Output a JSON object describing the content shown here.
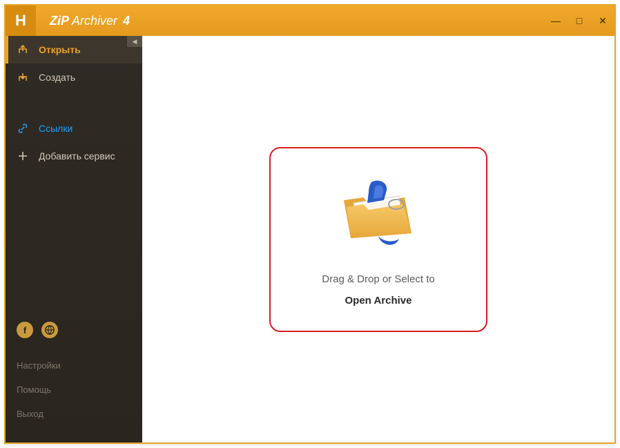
{
  "titlebar": {
    "logo_letter": "H",
    "zip": "ZiP",
    "archiver": "Archiver",
    "version": "4"
  },
  "window_controls": {
    "minimize": "—",
    "maximize": "□",
    "close": "✕"
  },
  "sidebar": {
    "collapse_glyph": "◀",
    "open": {
      "label": "Открыть"
    },
    "create": {
      "label": "Создать"
    },
    "links": {
      "label": "Ссылки"
    },
    "add_service": {
      "label": "Добавить сервис"
    }
  },
  "social": {
    "facebook": "f",
    "web": "⊕"
  },
  "bottom": {
    "settings": "Настройки",
    "help": "Помощь",
    "exit": "Выход"
  },
  "dropzone": {
    "line1": "Drag & Drop or Select to",
    "line2": "Open Archive"
  }
}
